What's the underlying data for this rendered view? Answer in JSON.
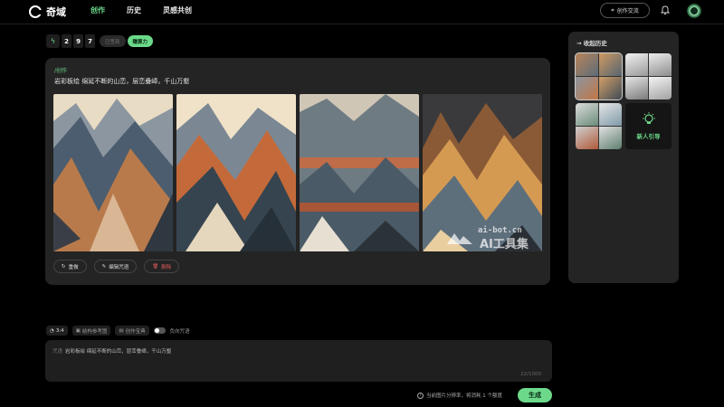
{
  "app": {
    "name": "奇域"
  },
  "nav": {
    "items": [
      "创作",
      "历史",
      "灵感共创"
    ],
    "active": "创作"
  },
  "header": {
    "exchange_label": "创作交流"
  },
  "stats": {
    "digits": [
      "2",
      "9",
      "7"
    ],
    "grey_pill": "已签到",
    "green_pill": "赚算力"
  },
  "result": {
    "tag": "/创作",
    "prompt": "岩彩板绘 绵延不断的山峦，层峦叠嶂，千山万壑",
    "actions": {
      "redo": "重做",
      "edit": "编辑咒语",
      "delete": "删除"
    }
  },
  "watermark": {
    "line1": "ai-bot.cn",
    "line2": "AI工具集"
  },
  "history": {
    "title": "收起历史",
    "guide_label": "新人引导"
  },
  "toolbar": {
    "ratio": "3:4",
    "ref": "结构参考图",
    "style": "创作宝典",
    "negative": "负向咒语"
  },
  "input": {
    "label": "咒语",
    "value": "岩彩板绘 绵延不断的山峦，层峦叠嶂，千山万壑",
    "count": "22/1000"
  },
  "footer": {
    "note": "当前图片分辨率，将消耗 1 个额度",
    "generate": "生成"
  },
  "colors": {
    "accent": "#6cd98a",
    "danger": "#e05a5a",
    "card": "#242424"
  }
}
